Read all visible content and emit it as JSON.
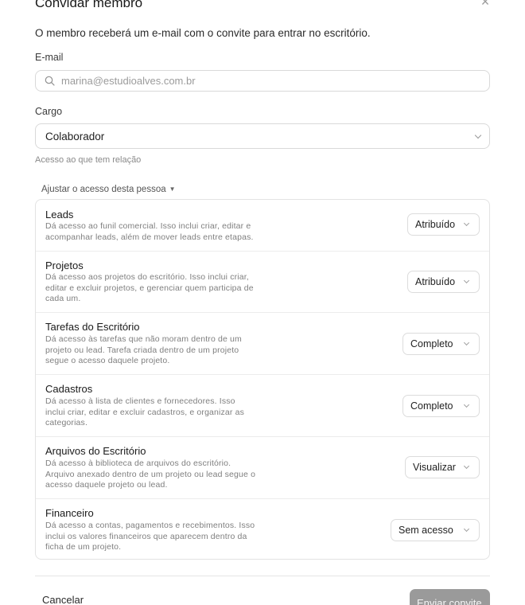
{
  "modal": {
    "title": "Convidar membro",
    "close_glyph": "×",
    "description": "O membro receberá um e-mail com o convite para entrar no escritório."
  },
  "email": {
    "label": "E-mail",
    "value": "",
    "placeholder": "marina@estudioalves.com.br",
    "icon": "search-icon"
  },
  "role": {
    "label": "Cargo",
    "selected": "Colaborador",
    "hint": "Acesso ao que tem relação"
  },
  "adjust": {
    "label": "Ajustar o acesso desta pessoa",
    "caret": "▼"
  },
  "permissions": [
    {
      "name": "Leads",
      "desc_lines": [
        "Dá acesso ao funil comercial. Isso inclui criar, editar e",
        "acompanhar leads, além de mover leads entre etapas."
      ],
      "level": "Atribuído"
    },
    {
      "name": "Projetos",
      "desc_lines": [
        "Dá acesso aos projetos do escritório. Isso inclui criar,",
        "editar e excluir projetos, e gerenciar quem participa de",
        "cada um."
      ],
      "level": "Atribuído"
    },
    {
      "name": "Tarefas do Escritório",
      "desc_lines": [
        "Dá acesso às tarefas que não moram dentro de um",
        "projeto ou lead. Tarefa criada dentro de um projeto",
        "segue o acesso daquele projeto."
      ],
      "level": "Completo"
    },
    {
      "name": "Cadastros",
      "desc_lines": [
        "Dá acesso à lista de clientes e fornecedores. Isso",
        "inclui criar, editar e excluir cadastros, e organizar as",
        "categorias."
      ],
      "level": "Completo"
    },
    {
      "name": "Arquivos do Escritório",
      "desc_lines": [
        "Dá acesso à biblioteca de arquivos do escritório.",
        "Arquivo anexado dentro de um projeto ou lead segue o",
        "acesso daquele projeto ou lead."
      ],
      "level": "Visualizar"
    },
    {
      "name": "Financeiro",
      "desc_lines": [
        "Dá acesso a contas, pagamentos e recebimentos. Isso",
        "inclui os valores financeiros que aparecem dentro da",
        "ficha de um projeto."
      ],
      "level": "Sem acesso"
    }
  ],
  "footer": {
    "cancel_label": "Cancelar",
    "send_label": "Enviar convite"
  },
  "colors": {
    "primary_button_disabled": "#9a9a9a",
    "border": "#d9d9d9",
    "muted_text": "#7f7f7f"
  }
}
